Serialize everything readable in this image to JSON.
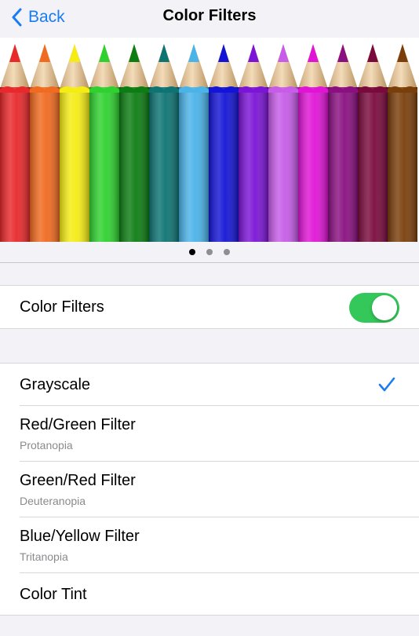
{
  "nav": {
    "back_label": "Back",
    "title": "Color Filters"
  },
  "pencils": {
    "colors": [
      "#e8282b",
      "#f06a1f",
      "#f5ec14",
      "#2fd12f",
      "#0c7d12",
      "#0d7373",
      "#4ab3e8",
      "#1414d6",
      "#7b14d6",
      "#c65ce8",
      "#e014d6",
      "#8a0f80",
      "#7a0a3c",
      "#7a3e0a"
    ]
  },
  "pager": {
    "pages": 3,
    "current": 1
  },
  "toggle_row": {
    "label": "Color Filters",
    "on": true,
    "accent": "#34c759"
  },
  "filters": [
    {
      "title": "Grayscale",
      "subtitle": "",
      "selected": true
    },
    {
      "title": "Red/Green Filter",
      "subtitle": "Protanopia",
      "selected": false
    },
    {
      "title": "Green/Red Filter",
      "subtitle": "Deuteranopia",
      "selected": false
    },
    {
      "title": "Blue/Yellow Filter",
      "subtitle": "Tritanopia",
      "selected": false
    },
    {
      "title": "Color Tint",
      "subtitle": "",
      "selected": false
    }
  ],
  "check_color": "#1a7cf5"
}
